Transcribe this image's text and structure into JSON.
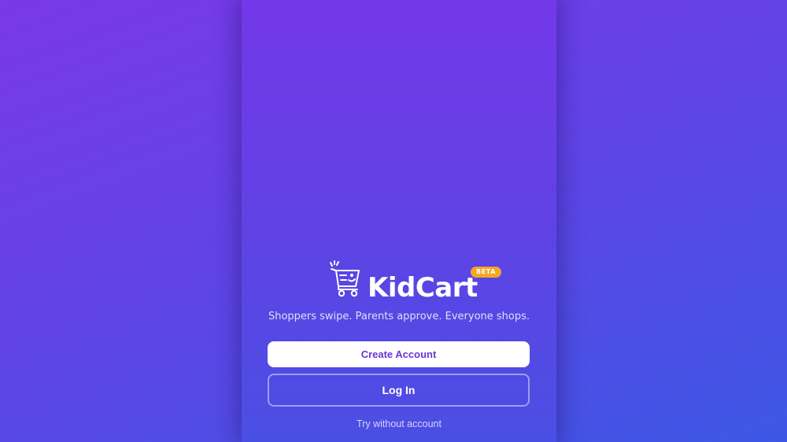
{
  "app": {
    "name": "KidCart",
    "badge": "BETA",
    "tagline": "Shoppers swipe. Parents approve. Everyone shops.",
    "logo_icon": "shopping-cart-icon"
  },
  "actions": {
    "create_account_label": "Create Account",
    "login_label": "Log In",
    "guest_label": "Try without account"
  },
  "colors": {
    "background_start": "#7a38e8",
    "background_end": "#3d57e5",
    "primary_button_bg": "#ffffff",
    "primary_button_text": "#6b35d9",
    "badge_bg": "#f5a623"
  }
}
